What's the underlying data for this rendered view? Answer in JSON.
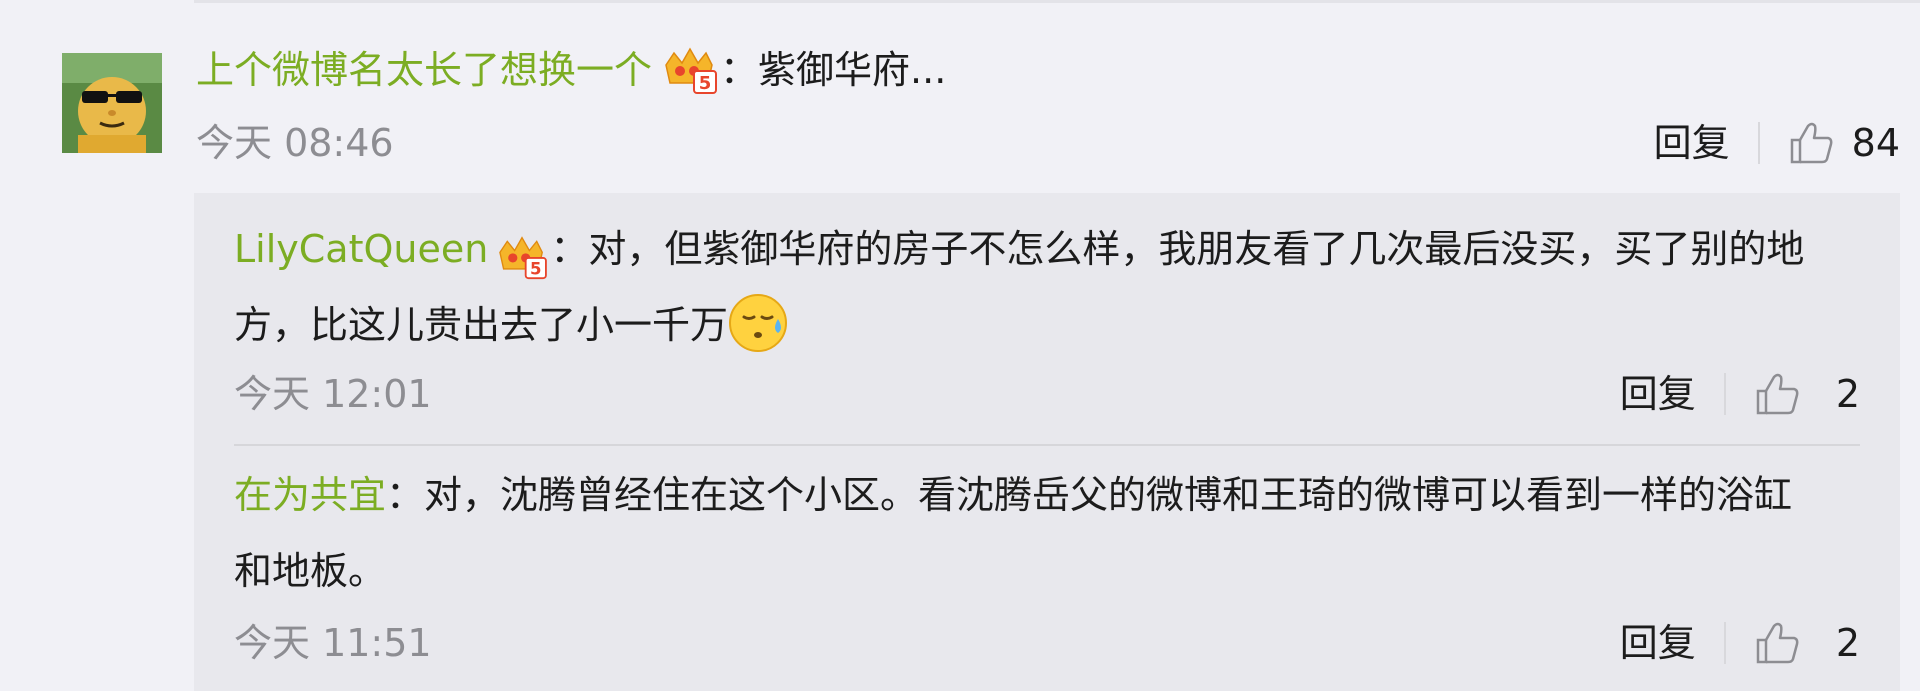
{
  "comment": {
    "username": "上个微博名太长了想换一个",
    "separator": "：",
    "text": "紫御华府...",
    "time": "今天 08:46",
    "reply_label": "回复",
    "like_count": "84",
    "badge_icon": "vip-crown-badge-icon",
    "like_icon": "thumbs-up-icon"
  },
  "replies": [
    {
      "username": "LilyCatQueen",
      "separator": "：",
      "text_line1": "对，但紫御华府的房子不怎么样，我朋友看了几次最后没买，买了别的地",
      "text_line2": "方，比这儿贵出去了小一千万",
      "emoji": "sweat-face-emoji-icon",
      "time": "今天 12:01",
      "reply_label": "回复",
      "like_count": "2"
    },
    {
      "username": "在为共宜",
      "separator": "：",
      "text_line1": "对，沈腾曾经住在这个小区。看沈腾岳父的微博和王琦的微博可以看到一样的浴缸",
      "text_line2": "和地板。",
      "time": "今天 11:51",
      "reply_label": "回复",
      "like_count": "2"
    }
  ],
  "colors": {
    "background": "#f1f1f6",
    "reply_background": "#e8e8ed",
    "username": "#7cad23",
    "timestamp": "#8d8d92",
    "badge_gold": "#f5b52a",
    "badge_red": "#e8452c"
  }
}
